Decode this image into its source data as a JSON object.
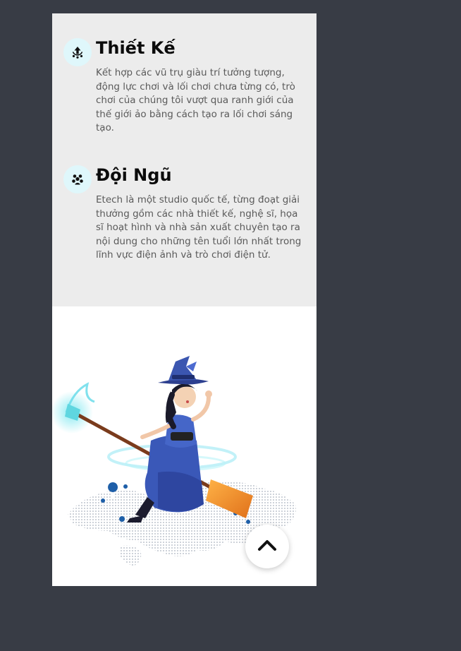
{
  "features": [
    {
      "title": "Thiết Kế",
      "description": "Kết hợp các vũ trụ giàu trí tưởng tượng, động lực chơi và lối chơi chưa từng có, trò chơi của chúng tôi vượt qua ranh giới của thế giới ảo bằng cách tạo ra lối chơi sáng tạo.",
      "icon": "design-upload-icon"
    },
    {
      "title": "Đội Ngũ",
      "description": "Etech là một studio quốc tế, từng đoạt giải thưởng gồm các nhà thiết kế, nghệ sĩ, họa sĩ hoạt hình và nhà sản xuất chuyên tạo ra nội dung cho những tên tuổi lớn nhất trong lĩnh vực điện ảnh và trò chơi điện tử.",
      "icon": "team-people-icon"
    }
  ],
  "illustration": {
    "subject": "witch-on-broom-over-world-map"
  },
  "back_to_top": {
    "icon": "chevron-up-icon"
  },
  "colors": {
    "page_background": "#383c45",
    "feature_background": "#ececec",
    "icon_circle": "#dff7fb",
    "title": "#0b0b0b",
    "body_text": "#5a5a5a"
  }
}
